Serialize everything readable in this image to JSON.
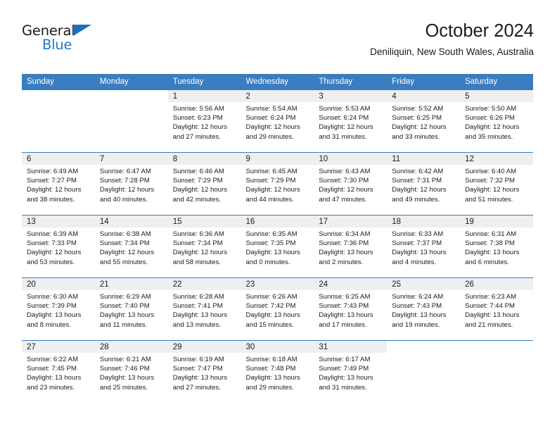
{
  "brand": {
    "name_part1": "General",
    "name_part2": "Blue",
    "triangle_color": "#1c6fba",
    "blue_color": "#1c7ad1"
  },
  "header": {
    "title": "October 2024",
    "subtitle": "Deniliquin, New South Wales, Australia"
  },
  "theme": {
    "header_bg": "#3a7dc0",
    "daynum_band": "#efefef",
    "text": "#1b1b1b"
  },
  "weekdays": [
    "Sunday",
    "Monday",
    "Tuesday",
    "Wednesday",
    "Thursday",
    "Friday",
    "Saturday"
  ],
  "weeks": [
    [
      {
        "day": "",
        "empty": true
      },
      {
        "day": "",
        "empty": true
      },
      {
        "day": "1",
        "sunrise": "Sunrise: 5:56 AM",
        "sunset": "Sunset: 6:23 PM",
        "daylight1": "Daylight: 12 hours",
        "daylight2": "and 27 minutes."
      },
      {
        "day": "2",
        "sunrise": "Sunrise: 5:54 AM",
        "sunset": "Sunset: 6:24 PM",
        "daylight1": "Daylight: 12 hours",
        "daylight2": "and 29 minutes."
      },
      {
        "day": "3",
        "sunrise": "Sunrise: 5:53 AM",
        "sunset": "Sunset: 6:24 PM",
        "daylight1": "Daylight: 12 hours",
        "daylight2": "and 31 minutes."
      },
      {
        "day": "4",
        "sunrise": "Sunrise: 5:52 AM",
        "sunset": "Sunset: 6:25 PM",
        "daylight1": "Daylight: 12 hours",
        "daylight2": "and 33 minutes."
      },
      {
        "day": "5",
        "sunrise": "Sunrise: 5:50 AM",
        "sunset": "Sunset: 6:26 PM",
        "daylight1": "Daylight: 12 hours",
        "daylight2": "and 35 minutes."
      }
    ],
    [
      {
        "day": "6",
        "sunrise": "Sunrise: 6:49 AM",
        "sunset": "Sunset: 7:27 PM",
        "daylight1": "Daylight: 12 hours",
        "daylight2": "and 38 minutes."
      },
      {
        "day": "7",
        "sunrise": "Sunrise: 6:47 AM",
        "sunset": "Sunset: 7:28 PM",
        "daylight1": "Daylight: 12 hours",
        "daylight2": "and 40 minutes."
      },
      {
        "day": "8",
        "sunrise": "Sunrise: 6:46 AM",
        "sunset": "Sunset: 7:29 PM",
        "daylight1": "Daylight: 12 hours",
        "daylight2": "and 42 minutes."
      },
      {
        "day": "9",
        "sunrise": "Sunrise: 6:45 AM",
        "sunset": "Sunset: 7:29 PM",
        "daylight1": "Daylight: 12 hours",
        "daylight2": "and 44 minutes."
      },
      {
        "day": "10",
        "sunrise": "Sunrise: 6:43 AM",
        "sunset": "Sunset: 7:30 PM",
        "daylight1": "Daylight: 12 hours",
        "daylight2": "and 47 minutes."
      },
      {
        "day": "11",
        "sunrise": "Sunrise: 6:42 AM",
        "sunset": "Sunset: 7:31 PM",
        "daylight1": "Daylight: 12 hours",
        "daylight2": "and 49 minutes."
      },
      {
        "day": "12",
        "sunrise": "Sunrise: 6:40 AM",
        "sunset": "Sunset: 7:32 PM",
        "daylight1": "Daylight: 12 hours",
        "daylight2": "and 51 minutes."
      }
    ],
    [
      {
        "day": "13",
        "sunrise": "Sunrise: 6:39 AM",
        "sunset": "Sunset: 7:33 PM",
        "daylight1": "Daylight: 12 hours",
        "daylight2": "and 53 minutes."
      },
      {
        "day": "14",
        "sunrise": "Sunrise: 6:38 AM",
        "sunset": "Sunset: 7:34 PM",
        "daylight1": "Daylight: 12 hours",
        "daylight2": "and 55 minutes."
      },
      {
        "day": "15",
        "sunrise": "Sunrise: 6:36 AM",
        "sunset": "Sunset: 7:34 PM",
        "daylight1": "Daylight: 12 hours",
        "daylight2": "and 58 minutes."
      },
      {
        "day": "16",
        "sunrise": "Sunrise: 6:35 AM",
        "sunset": "Sunset: 7:35 PM",
        "daylight1": "Daylight: 13 hours",
        "daylight2": "and 0 minutes."
      },
      {
        "day": "17",
        "sunrise": "Sunrise: 6:34 AM",
        "sunset": "Sunset: 7:36 PM",
        "daylight1": "Daylight: 13 hours",
        "daylight2": "and 2 minutes."
      },
      {
        "day": "18",
        "sunrise": "Sunrise: 6:33 AM",
        "sunset": "Sunset: 7:37 PM",
        "daylight1": "Daylight: 13 hours",
        "daylight2": "and 4 minutes."
      },
      {
        "day": "19",
        "sunrise": "Sunrise: 6:31 AM",
        "sunset": "Sunset: 7:38 PM",
        "daylight1": "Daylight: 13 hours",
        "daylight2": "and 6 minutes."
      }
    ],
    [
      {
        "day": "20",
        "sunrise": "Sunrise: 6:30 AM",
        "sunset": "Sunset: 7:39 PM",
        "daylight1": "Daylight: 13 hours",
        "daylight2": "and 8 minutes."
      },
      {
        "day": "21",
        "sunrise": "Sunrise: 6:29 AM",
        "sunset": "Sunset: 7:40 PM",
        "daylight1": "Daylight: 13 hours",
        "daylight2": "and 11 minutes."
      },
      {
        "day": "22",
        "sunrise": "Sunrise: 6:28 AM",
        "sunset": "Sunset: 7:41 PM",
        "daylight1": "Daylight: 13 hours",
        "daylight2": "and 13 minutes."
      },
      {
        "day": "23",
        "sunrise": "Sunrise: 6:26 AM",
        "sunset": "Sunset: 7:42 PM",
        "daylight1": "Daylight: 13 hours",
        "daylight2": "and 15 minutes."
      },
      {
        "day": "24",
        "sunrise": "Sunrise: 6:25 AM",
        "sunset": "Sunset: 7:43 PM",
        "daylight1": "Daylight: 13 hours",
        "daylight2": "and 17 minutes."
      },
      {
        "day": "25",
        "sunrise": "Sunrise: 6:24 AM",
        "sunset": "Sunset: 7:43 PM",
        "daylight1": "Daylight: 13 hours",
        "daylight2": "and 19 minutes."
      },
      {
        "day": "26",
        "sunrise": "Sunrise: 6:23 AM",
        "sunset": "Sunset: 7:44 PM",
        "daylight1": "Daylight: 13 hours",
        "daylight2": "and 21 minutes."
      }
    ],
    [
      {
        "day": "27",
        "sunrise": "Sunrise: 6:22 AM",
        "sunset": "Sunset: 7:45 PM",
        "daylight1": "Daylight: 13 hours",
        "daylight2": "and 23 minutes."
      },
      {
        "day": "28",
        "sunrise": "Sunrise: 6:21 AM",
        "sunset": "Sunset: 7:46 PM",
        "daylight1": "Daylight: 13 hours",
        "daylight2": "and 25 minutes."
      },
      {
        "day": "29",
        "sunrise": "Sunrise: 6:19 AM",
        "sunset": "Sunset: 7:47 PM",
        "daylight1": "Daylight: 13 hours",
        "daylight2": "and 27 minutes."
      },
      {
        "day": "30",
        "sunrise": "Sunrise: 6:18 AM",
        "sunset": "Sunset: 7:48 PM",
        "daylight1": "Daylight: 13 hours",
        "daylight2": "and 29 minutes."
      },
      {
        "day": "31",
        "sunrise": "Sunrise: 6:17 AM",
        "sunset": "Sunset: 7:49 PM",
        "daylight1": "Daylight: 13 hours",
        "daylight2": "and 31 minutes."
      },
      {
        "day": "",
        "empty": true
      },
      {
        "day": "",
        "empty": true
      }
    ]
  ]
}
